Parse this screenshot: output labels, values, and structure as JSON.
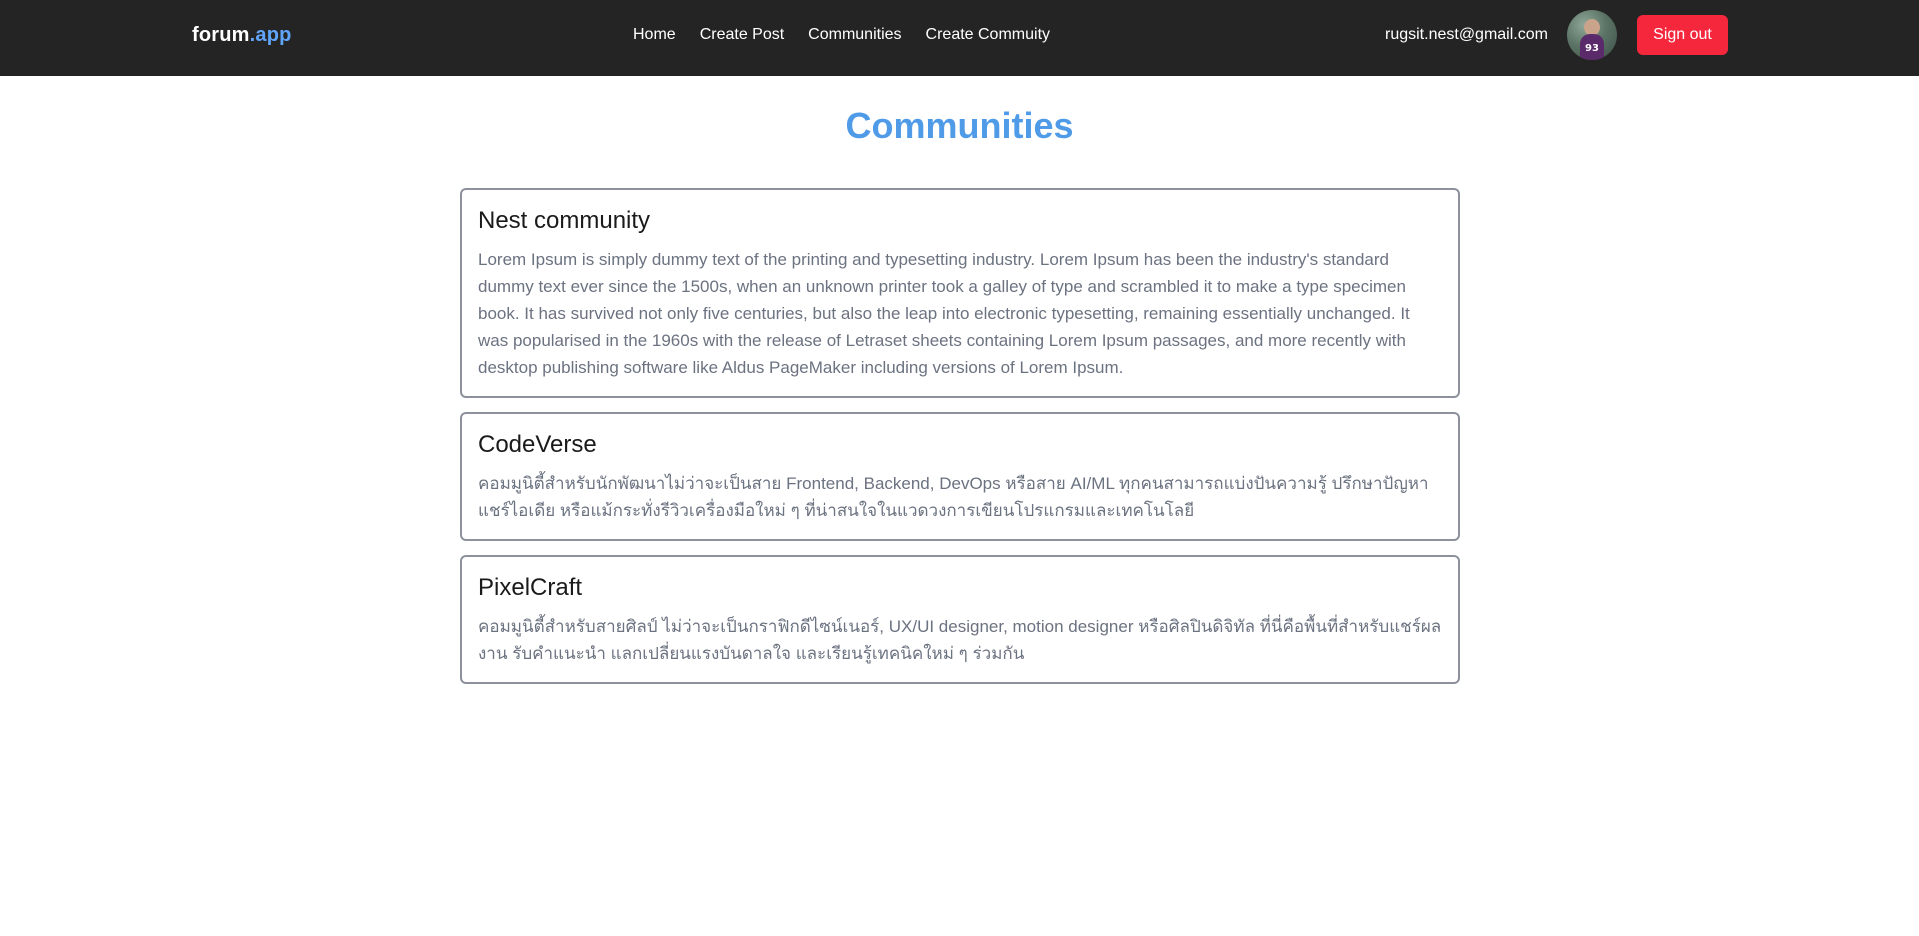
{
  "navbar": {
    "brand_main": "forum",
    "brand_suffix": ".app",
    "links": [
      "Home",
      "Create Post",
      "Communities",
      "Create Commuity"
    ],
    "user_email": "rugsit.nest@gmail.com",
    "avatar_number": "93",
    "signout_label": "Sign out"
  },
  "page": {
    "title": "Communities"
  },
  "communities": [
    {
      "name": "Nest community",
      "description": "Lorem Ipsum is simply dummy text of the printing and typesetting industry. Lorem Ipsum has been the industry's standard dummy text ever since the 1500s, when an unknown printer took a galley of type and scrambled it to make a type specimen book. It has survived not only five centuries, but also the leap into electronic typesetting, remaining essentially unchanged. It was popularised in the 1960s with the release of Letraset sheets containing Lorem Ipsum passages, and more recently with desktop publishing software like Aldus PageMaker including versions of Lorem Ipsum."
    },
    {
      "name": "CodeVerse",
      "description": "คอมมูนิตี้สำหรับนักพัฒนาไม่ว่าจะเป็นสาย Frontend, Backend, DevOps หรือสาย AI/ML ทุกคนสามารถแบ่งปันความรู้ ปรึกษาปัญหา แชร์ไอเดีย หรือแม้กระทั่งรีวิวเครื่องมือใหม่ ๆ ที่น่าสนใจในแวดวงการเขียนโปรแกรมและเทคโนโลยี"
    },
    {
      "name": "PixelCraft",
      "description": "คอมมูนิตี้สำหรับสายศิลป์ ไม่ว่าจะเป็นกราฟิกดีไซน์เนอร์, UX/UI designer, motion designer หรือศิลปินดิจิทัล ที่นี่คือพื้นที่สำหรับแชร์ผลงาน รับคำแนะนำ แลกเปลี่ยนแรงบันดาลใจ และเรียนรู้เทคนิคใหม่ ๆ ร่วมกัน"
    }
  ],
  "colors": {
    "navbar_bg": "#242424",
    "brand_accent": "#60a5fa",
    "title": "#4f9be8",
    "signout_bg": "#f4273d",
    "card_border": "#8c919c",
    "desc_text": "#6b7280"
  }
}
